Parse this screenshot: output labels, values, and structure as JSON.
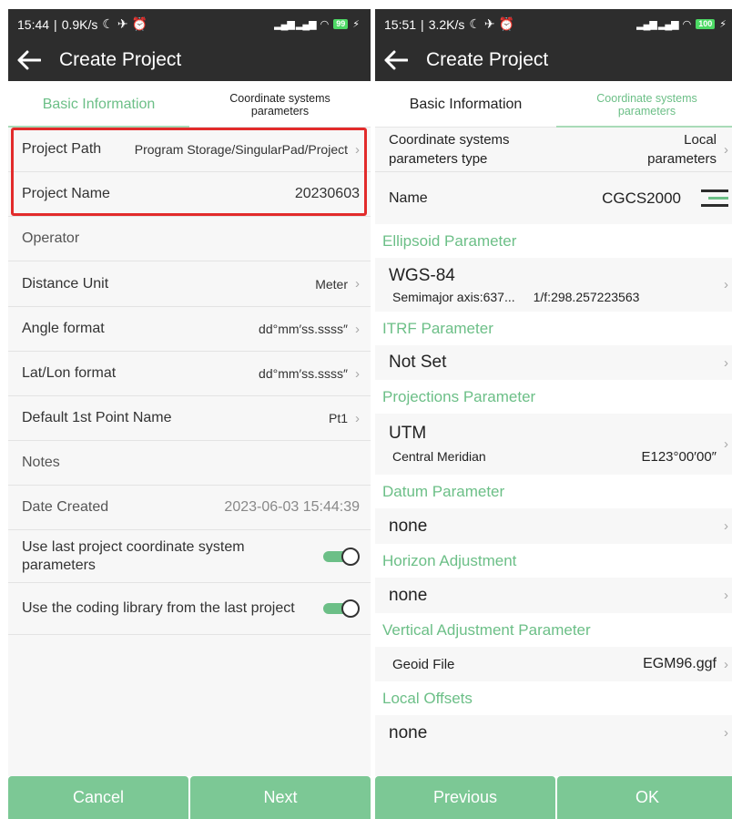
{
  "left": {
    "status": {
      "time": "15:44",
      "speed": "0.9K/s",
      "battery": "99"
    },
    "title": "Create Project",
    "tabs": {
      "basic": "Basic Information",
      "coord": "Coordinate systems parameters"
    },
    "rows": {
      "project_path_label": "Project Path",
      "project_path_value": "Program Storage/SingularPad/Project",
      "project_name_label": "Project Name",
      "project_name_value": "20230603",
      "operator_label": "Operator",
      "distance_unit_label": "Distance Unit",
      "distance_unit_value": "Meter",
      "angle_format_label": "Angle format",
      "angle_format_value": "dd°mm′ss.ssss″",
      "latlon_format_label": "Lat/Lon format",
      "latlon_format_value": "dd°mm′ss.ssss″",
      "first_point_label": "Default 1st Point Name",
      "first_point_value": "Pt1",
      "notes_label": "Notes",
      "date_created_label": "Date Created",
      "date_created_value": "2023-06-03 15:44:39",
      "use_last_coord_label": "Use last project coordinate system parameters",
      "use_coding_label": "Use the coding library from the last project"
    },
    "buttons": {
      "cancel": "Cancel",
      "next": "Next"
    }
  },
  "right": {
    "status": {
      "time": "15:51",
      "speed": "3.2K/s",
      "battery": "100"
    },
    "title": "Create Project",
    "tabs": {
      "basic": "Basic Information",
      "coord": "Coordinate systems parameters"
    },
    "type_label": "Coordinate systems parameters type",
    "type_value": "Local parameters",
    "name_label": "Name",
    "name_value": "CGCS2000",
    "sections": {
      "ellipsoid": "Ellipsoid Parameter",
      "itrf": "ITRF Parameter",
      "projections": "Projections Parameter",
      "datum": "Datum Parameter",
      "horizon": "Horizon Adjustment",
      "vertical": "Vertical Adjustment Parameter",
      "offsets": "Local Offsets"
    },
    "ellipsoid": {
      "name": "WGS-84",
      "semimajor": "Semimajor axis:637...",
      "flattening": "1/f:298.257223563"
    },
    "itrf_value": "Not Set",
    "projection": {
      "name": "UTM",
      "cm_label": "Central Meridian",
      "cm_value": "E123°00′00″"
    },
    "datum_value": "none",
    "horizon_value": "none",
    "geoid_label": "Geoid File",
    "geoid_value": "EGM96.ggf",
    "offsets_value": "none",
    "buttons": {
      "previous": "Previous",
      "ok": "OK"
    }
  },
  "colors": {
    "accent": "#6cbf87",
    "button": "#7cc895",
    "highlight": "#e22b2b",
    "bar": "#2d2d2d"
  },
  "icons": [
    "arrow-left-icon",
    "chevron-right-icon",
    "toggle-switch",
    "list-icon",
    "signal-icon",
    "wifi-icon",
    "battery-icon"
  ]
}
